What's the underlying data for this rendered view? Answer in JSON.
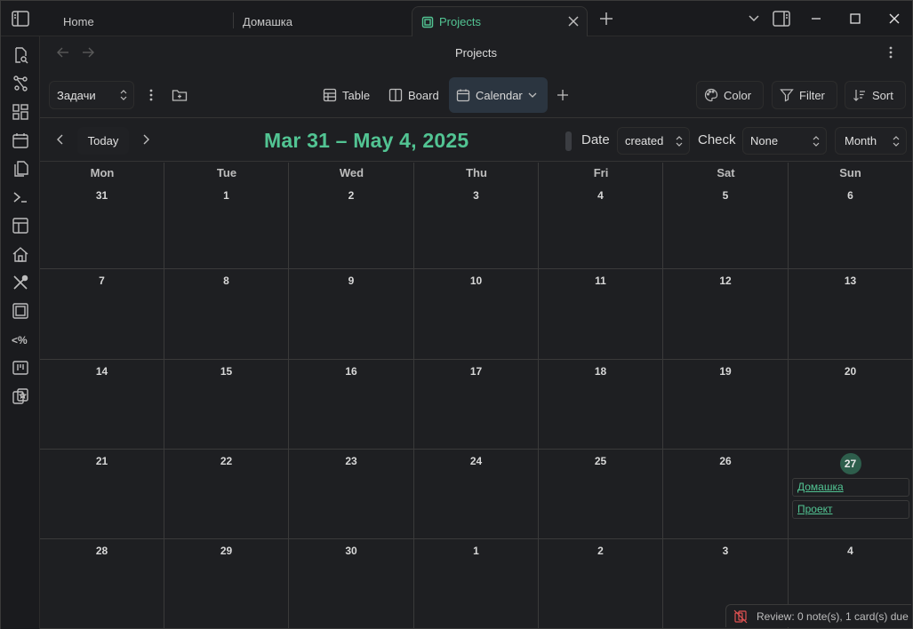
{
  "tabs": [
    {
      "label": "Home",
      "active": false
    },
    {
      "label": "Домашка",
      "active": false
    },
    {
      "label": "Projects",
      "active": true
    }
  ],
  "view": {
    "title": "Projects"
  },
  "toolbar": {
    "base_select": "Задачи",
    "views": [
      "Table",
      "Board",
      "Calendar"
    ],
    "active_view": "Calendar",
    "color_label": "Color",
    "filter_label": "Filter",
    "sort_label": "Sort"
  },
  "calendar": {
    "today_label": "Today",
    "range_title": "Mar 31 – May 4, 2025",
    "date_label": "Date",
    "date_field": "created",
    "check_label": "Check",
    "check_field": "None",
    "period": "Month",
    "weekdays": [
      "Mon",
      "Tue",
      "Wed",
      "Thu",
      "Fri",
      "Sat",
      "Sun"
    ],
    "days": [
      "31",
      "1",
      "2",
      "3",
      "4",
      "5",
      "6",
      "7",
      "8",
      "9",
      "10",
      "11",
      "12",
      "13",
      "14",
      "15",
      "16",
      "17",
      "18",
      "19",
      "20",
      "21",
      "22",
      "23",
      "24",
      "25",
      "26",
      "27",
      "28",
      "29",
      "30",
      "1",
      "2",
      "3",
      "4"
    ],
    "today_day": "27",
    "events": [
      {
        "day": "27",
        "title": "Домашка"
      },
      {
        "day": "27",
        "title": "Проект"
      }
    ]
  },
  "status": {
    "review_text": "Review: 0 note(s), 1 card(s) due"
  },
  "colors": {
    "accent": "#52c493",
    "background": "#1e1f22",
    "today_circle": "#2e5e4c"
  },
  "ribbon_icons": [
    "file-search-icon",
    "graph-icon",
    "grid-icon",
    "calendar-icon",
    "files-icon",
    "terminal-icon",
    "layout-icon",
    "home-icon",
    "tools-icon",
    "layers-icon",
    "template-icon",
    "kanban-icon",
    "flashcards-icon"
  ]
}
